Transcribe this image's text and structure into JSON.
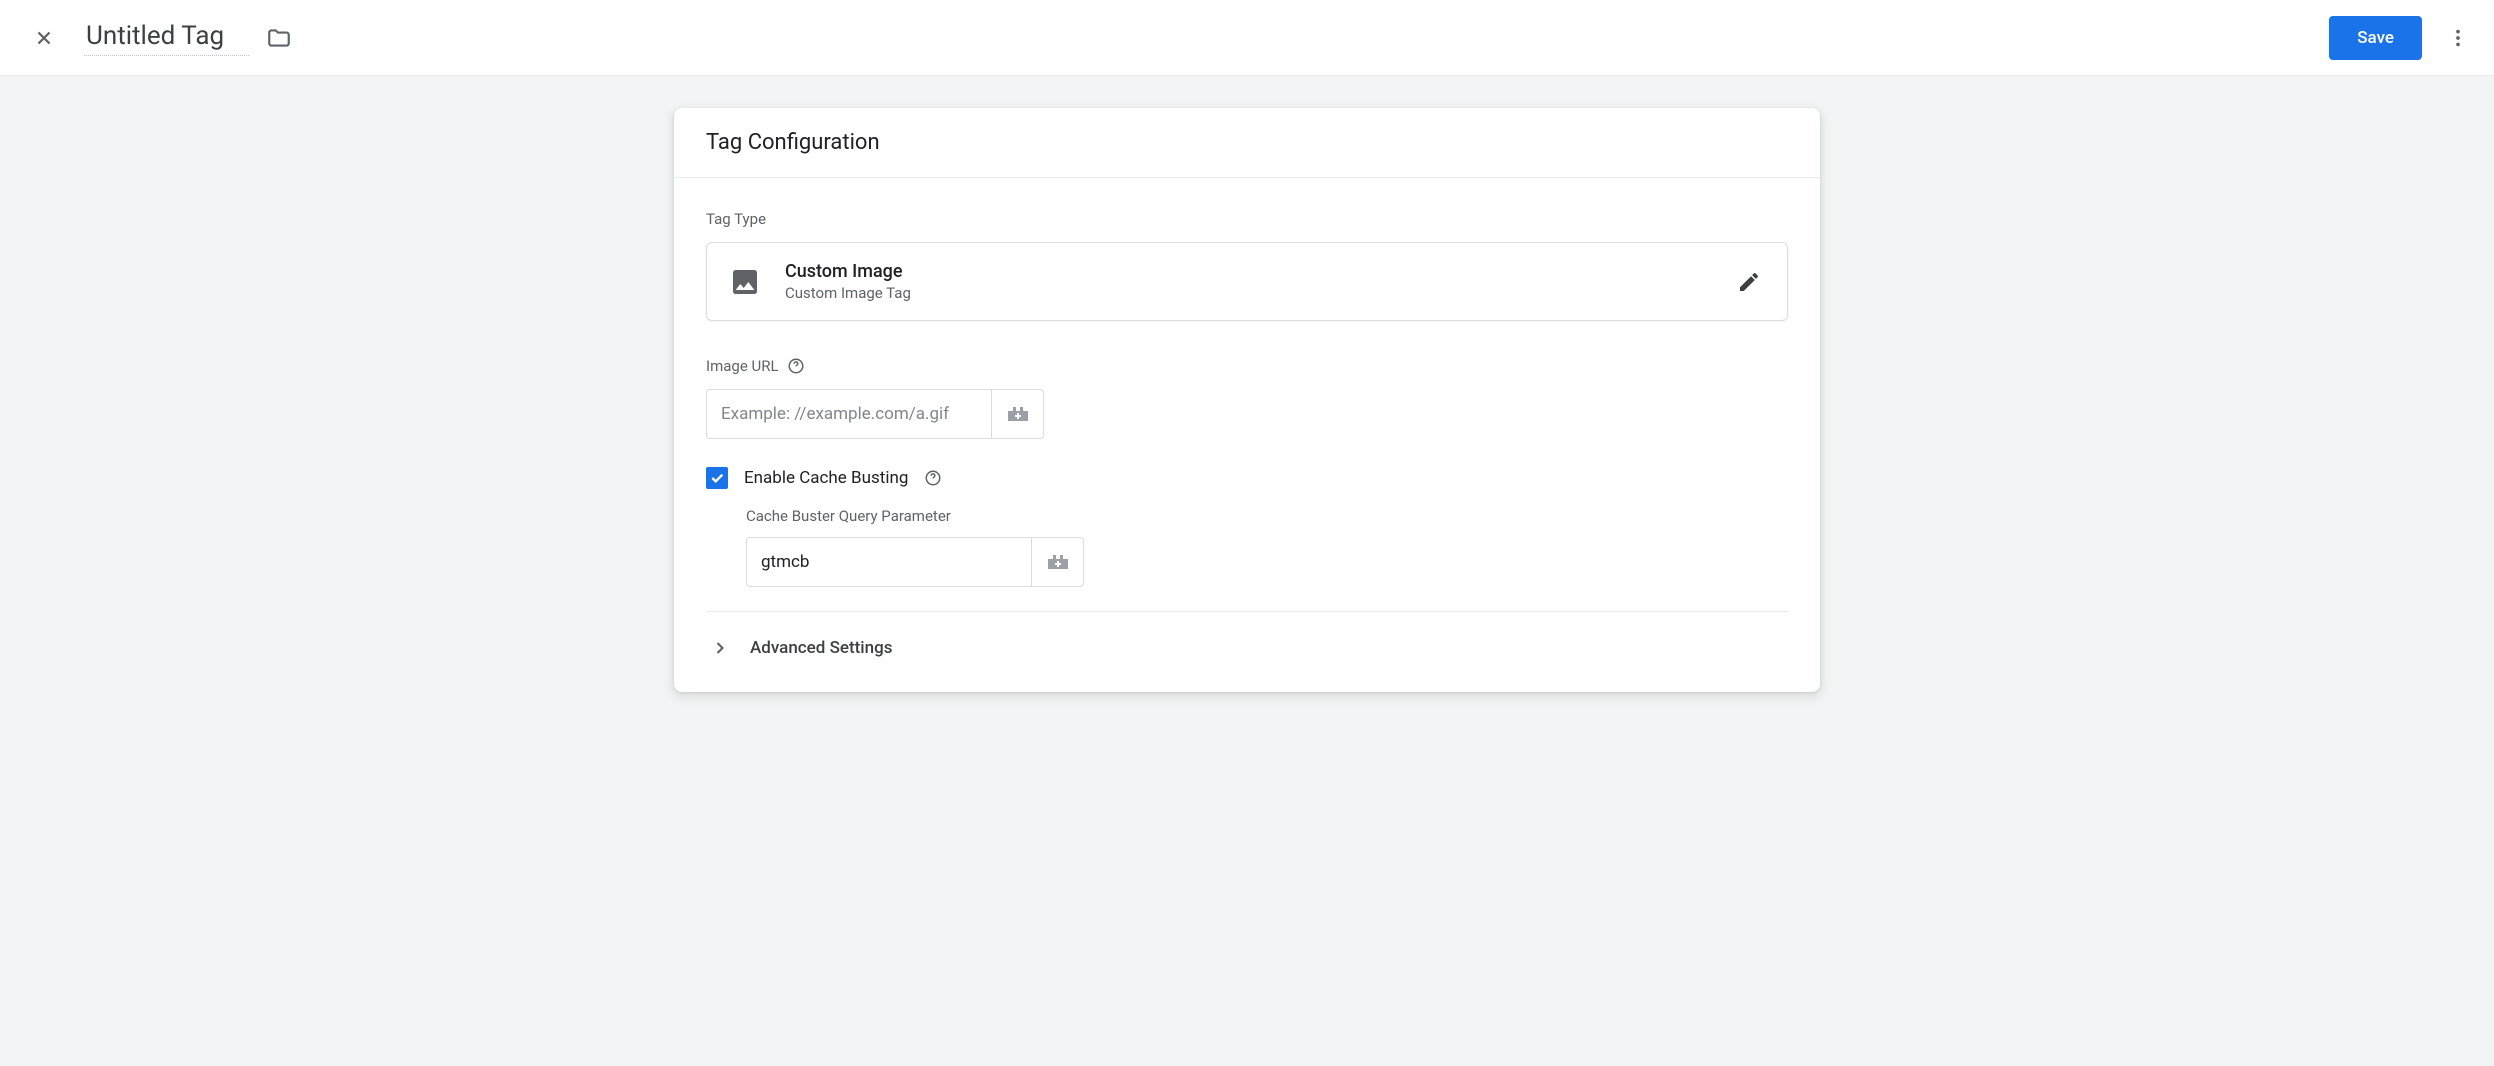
{
  "header": {
    "title": "Untitled Tag",
    "save_label": "Save"
  },
  "card": {
    "title": "Tag Configuration",
    "tag_type_label": "Tag Type",
    "tag_type": {
      "name": "Custom Image",
      "description": "Custom Image Tag"
    },
    "image_url": {
      "label": "Image URL",
      "placeholder": "Example: //example.com/a.gif",
      "value": ""
    },
    "cache_busting": {
      "label": "Enable Cache Busting",
      "checked": true,
      "param_label": "Cache Buster Query Parameter",
      "param_value": "gtmcb"
    },
    "advanced_label": "Advanced Settings"
  }
}
